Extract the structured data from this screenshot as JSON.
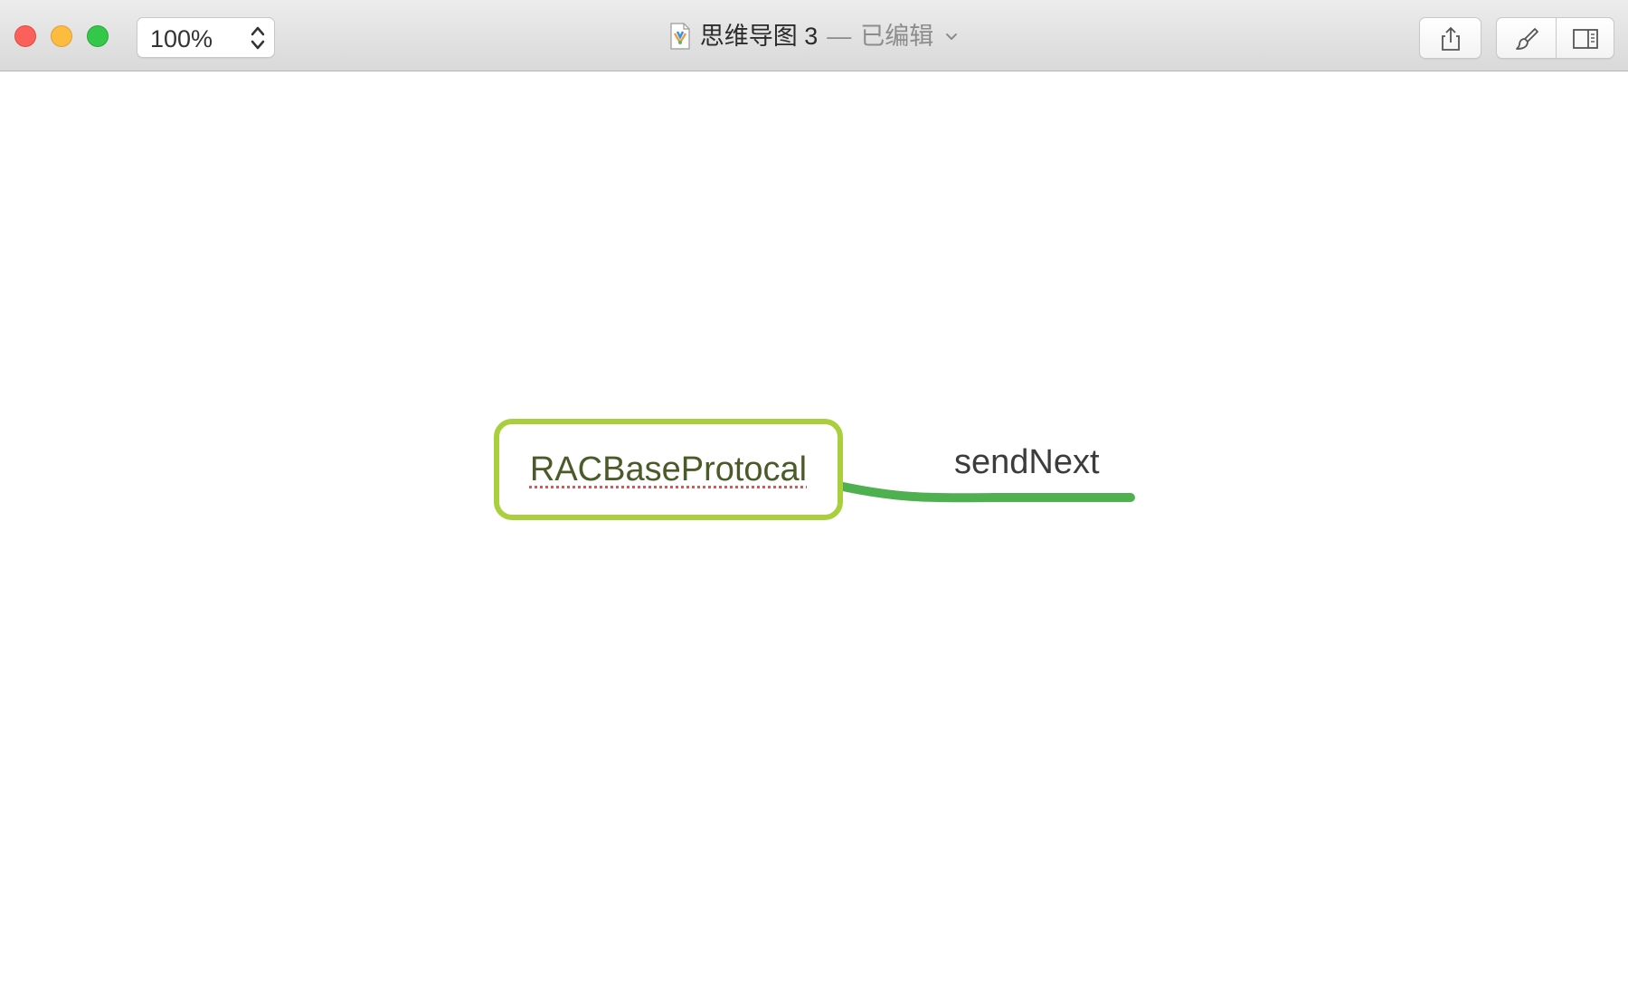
{
  "window": {
    "title": "思维导图 3",
    "separator": "—",
    "status": "已编辑"
  },
  "toolbar": {
    "zoom_value": "100%",
    "share_icon": "share-icon",
    "format_icon": "brush-icon",
    "sidebar_icon": "sidebar-toggle-icon"
  },
  "mindmap": {
    "central_topic": "RACBaseProtocal",
    "subtopics": [
      {
        "label": "sendNext"
      }
    ]
  },
  "colors": {
    "central_border": "#a9cf3d",
    "branch": "#4fb04f",
    "close": "#fc605b",
    "minimize": "#fdbc40",
    "zoom": "#34c84a"
  }
}
